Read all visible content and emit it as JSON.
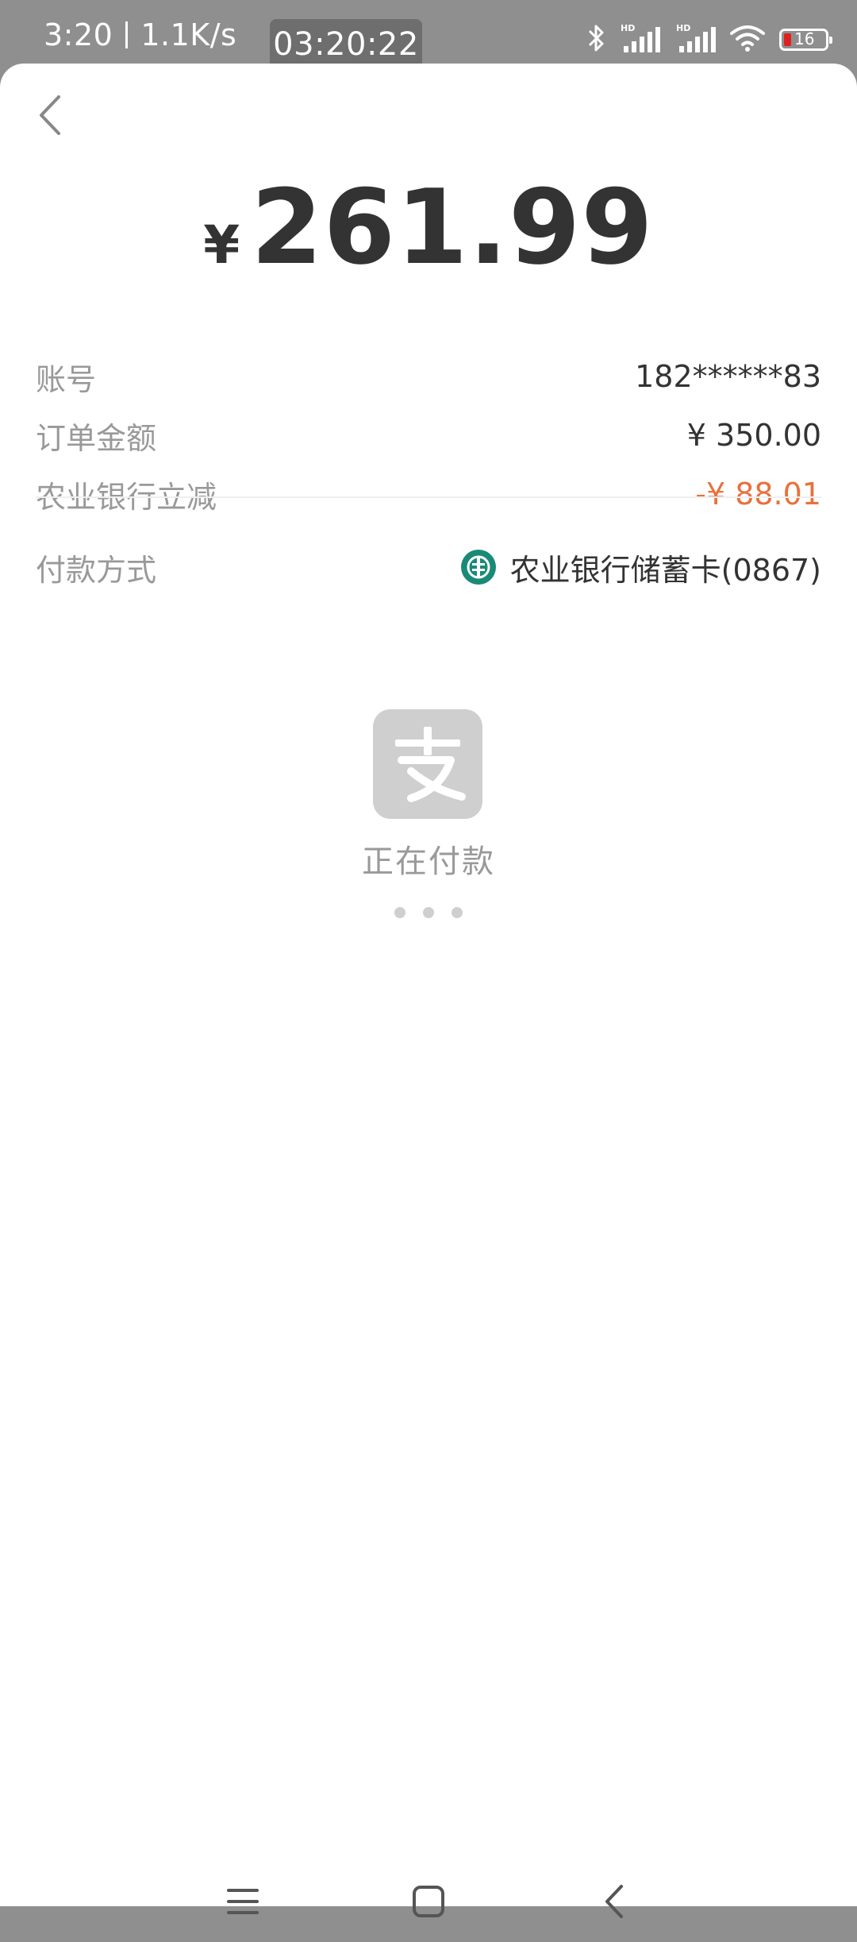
{
  "status_bar": {
    "time": "3:20",
    "net_speed": "1.1K/s",
    "timer": "03:20:22",
    "battery_level": "16",
    "icons": [
      "bluetooth-icon",
      "hd-signal-icon",
      "hd-signal-icon",
      "wifi-icon",
      "battery-icon"
    ]
  },
  "header": {
    "back_icon": "chevron-left-icon"
  },
  "amount": {
    "currency": "¥",
    "value": "261.99"
  },
  "details": [
    {
      "label": "账号",
      "value": "182******83"
    },
    {
      "label": "订单金额",
      "value": "¥ 350.00"
    },
    {
      "label": "农业银行立减",
      "value": "-¥ 88.01"
    }
  ],
  "payment": {
    "label": "付款方式",
    "method": "农业银行储蓄卡(0867)",
    "bank_icon": "abc-bank-icon"
  },
  "loading": {
    "logo_icon": "alipay-icon",
    "text": "正在付款"
  },
  "nav": {
    "icons": [
      "menu-icon",
      "home-icon",
      "back-icon"
    ]
  },
  "colors": {
    "discount": "#e8703d",
    "label": "#999999",
    "text": "#333333",
    "bank": "#1a8a76",
    "logo_bg": "#cfcfcf"
  }
}
